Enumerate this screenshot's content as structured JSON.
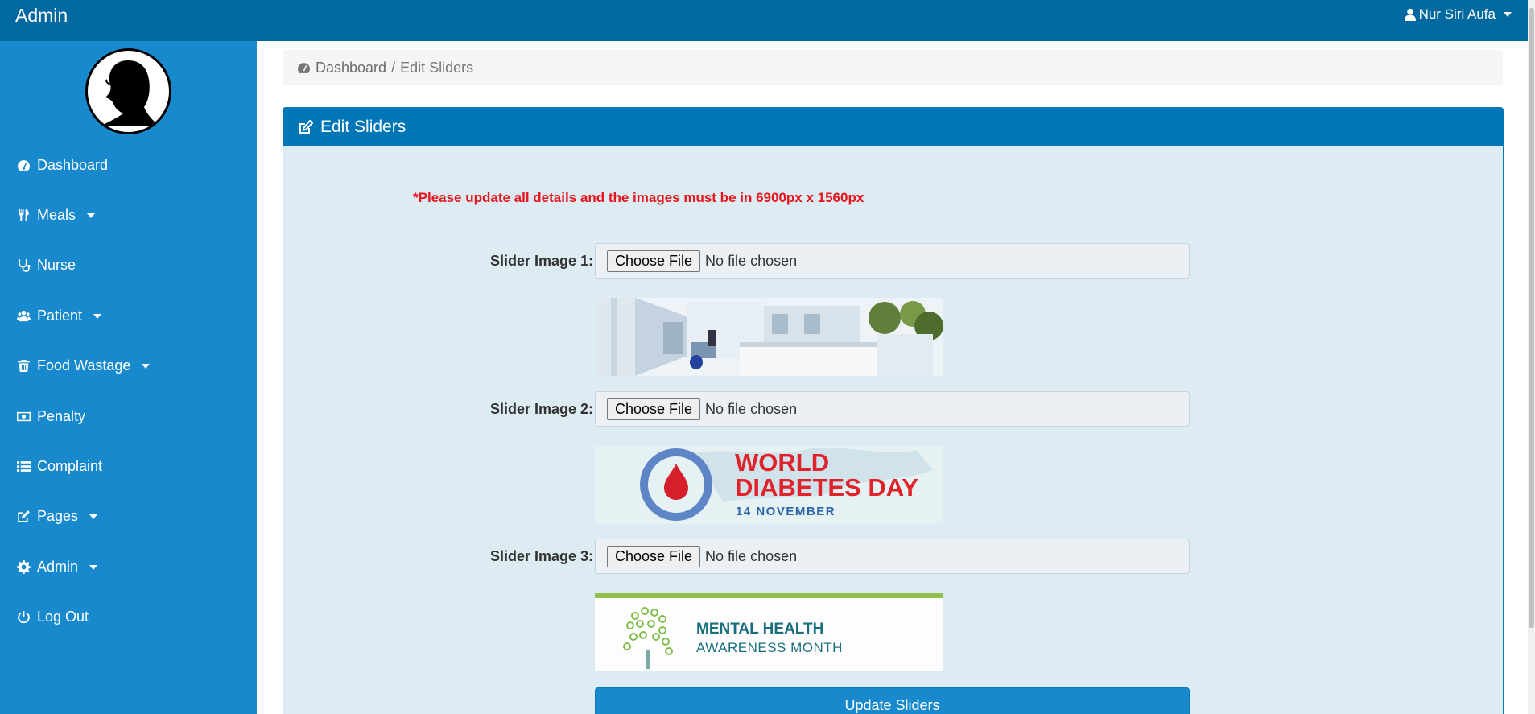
{
  "topbar": {
    "brand": "Admin",
    "user_name": "Nur Siri Aufa"
  },
  "sidebar": {
    "items": [
      {
        "label": "Dashboard",
        "icon": "dashboard-icon"
      },
      {
        "label": "Meals",
        "icon": "cutlery-icon",
        "has_dropdown": true
      },
      {
        "label": "Nurse",
        "icon": "stethoscope-icon"
      },
      {
        "label": "Patient",
        "icon": "users-icon",
        "has_dropdown": true
      },
      {
        "label": "Food Wastage",
        "icon": "trash-icon",
        "has_dropdown": true
      },
      {
        "label": "Penalty",
        "icon": "money-icon"
      },
      {
        "label": "Complaint",
        "icon": "list-icon"
      },
      {
        "label": "Pages",
        "icon": "edit-icon",
        "has_dropdown": true
      },
      {
        "label": "Admin",
        "icon": "gear-icon",
        "has_dropdown": true
      },
      {
        "label": "Log Out",
        "icon": "power-icon"
      }
    ]
  },
  "breadcrumb": {
    "home": "Dashboard",
    "separator": "/",
    "current": "Edit Sliders"
  },
  "panel": {
    "title": "Edit Sliders",
    "notice": "*Please update all details and the images must be in 6900px x 1560px",
    "sliders": [
      {
        "label": "Slider Image 1:",
        "button": "Choose File",
        "status": "No file chosen"
      },
      {
        "label": "Slider Image 2:",
        "button": "Choose File",
        "status": "No file chosen",
        "image_text": {
          "line1": "WORLD",
          "line2": "DIABETES DAY",
          "line3": "14 NOVEMBER"
        }
      },
      {
        "label": "Slider Image 3:",
        "button": "Choose File",
        "status": "No file chosen",
        "image_text": {
          "line1": "MENTAL HEALTH",
          "line2": "AWARENESS MONTH"
        }
      }
    ],
    "submit_label": "Update Sliders"
  },
  "colors": {
    "topbar": "#0168a0",
    "sidebar": "#1889cc",
    "panel_header": "#0076b7",
    "panel_body": "#ddebf3",
    "notice": "#e8141c"
  }
}
